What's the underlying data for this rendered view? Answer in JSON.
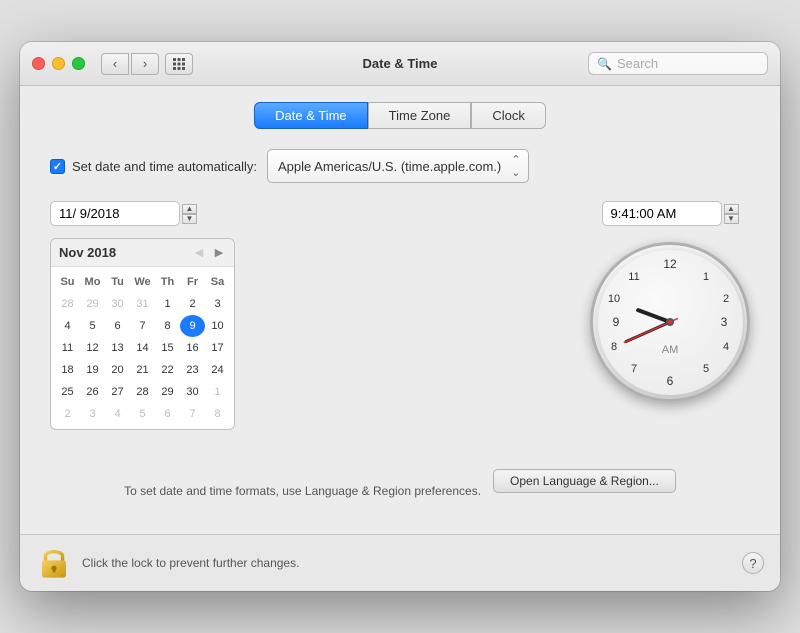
{
  "window": {
    "title": "Date & Time"
  },
  "titlebar": {
    "back_label": "‹",
    "forward_label": "›",
    "grid_label": "⊞"
  },
  "search": {
    "placeholder": "Search"
  },
  "tabs": [
    {
      "id": "date-time",
      "label": "Date & Time",
      "active": true
    },
    {
      "id": "time-zone",
      "label": "Time Zone",
      "active": false
    },
    {
      "id": "clock",
      "label": "Clock",
      "active": false
    }
  ],
  "auto_set": {
    "label": "Set date and time automatically:",
    "server": "Apple Americas/U.S. (time.apple.com.)"
  },
  "date_input": {
    "value": "11/  9/2018"
  },
  "time_input": {
    "value": "9:41:00 AM"
  },
  "calendar": {
    "month_year": "Nov 2018",
    "headers": [
      "Su",
      "Mo",
      "Tu",
      "We",
      "Th",
      "Fr",
      "Sa"
    ],
    "weeks": [
      [
        {
          "day": "28",
          "type": "other"
        },
        {
          "day": "29",
          "type": "other"
        },
        {
          "day": "30",
          "type": "other"
        },
        {
          "day": "31",
          "type": "other"
        },
        {
          "day": "1",
          "type": "normal"
        },
        {
          "day": "2",
          "type": "normal"
        },
        {
          "day": "3",
          "type": "normal"
        }
      ],
      [
        {
          "day": "4",
          "type": "normal"
        },
        {
          "day": "5",
          "type": "normal"
        },
        {
          "day": "6",
          "type": "normal"
        },
        {
          "day": "7",
          "type": "normal"
        },
        {
          "day": "8",
          "type": "normal"
        },
        {
          "day": "9",
          "type": "selected"
        },
        {
          "day": "10",
          "type": "normal"
        }
      ],
      [
        {
          "day": "11",
          "type": "normal"
        },
        {
          "day": "12",
          "type": "normal"
        },
        {
          "day": "13",
          "type": "normal"
        },
        {
          "day": "14",
          "type": "normal"
        },
        {
          "day": "15",
          "type": "normal"
        },
        {
          "day": "16",
          "type": "normal"
        },
        {
          "day": "17",
          "type": "normal"
        }
      ],
      [
        {
          "day": "18",
          "type": "normal"
        },
        {
          "day": "19",
          "type": "normal"
        },
        {
          "day": "20",
          "type": "normal"
        },
        {
          "day": "21",
          "type": "normal"
        },
        {
          "day": "22",
          "type": "normal"
        },
        {
          "day": "23",
          "type": "normal"
        },
        {
          "day": "24",
          "type": "normal"
        }
      ],
      [
        {
          "day": "25",
          "type": "normal"
        },
        {
          "day": "26",
          "type": "normal"
        },
        {
          "day": "27",
          "type": "normal"
        },
        {
          "day": "28",
          "type": "normal"
        },
        {
          "day": "29",
          "type": "normal"
        },
        {
          "day": "30",
          "type": "normal"
        },
        {
          "day": "1",
          "type": "other"
        }
      ],
      [
        {
          "day": "2",
          "type": "other"
        },
        {
          "day": "3",
          "type": "other"
        },
        {
          "day": "4",
          "type": "other"
        },
        {
          "day": "5",
          "type": "other"
        },
        {
          "day": "6",
          "type": "other"
        },
        {
          "day": "7",
          "type": "other"
        },
        {
          "day": "8",
          "type": "other"
        }
      ]
    ]
  },
  "clock": {
    "am_label": "AM",
    "hour_rotation": -60,
    "minute_rotation": 210,
    "second_rotation": 207
  },
  "footer": {
    "text": "To set date and time formats, use Language & Region preferences.",
    "button_label": "Open Language & Region..."
  },
  "bottom_bar": {
    "lock_text": "Click the lock to prevent further changes.",
    "help_label": "?"
  }
}
